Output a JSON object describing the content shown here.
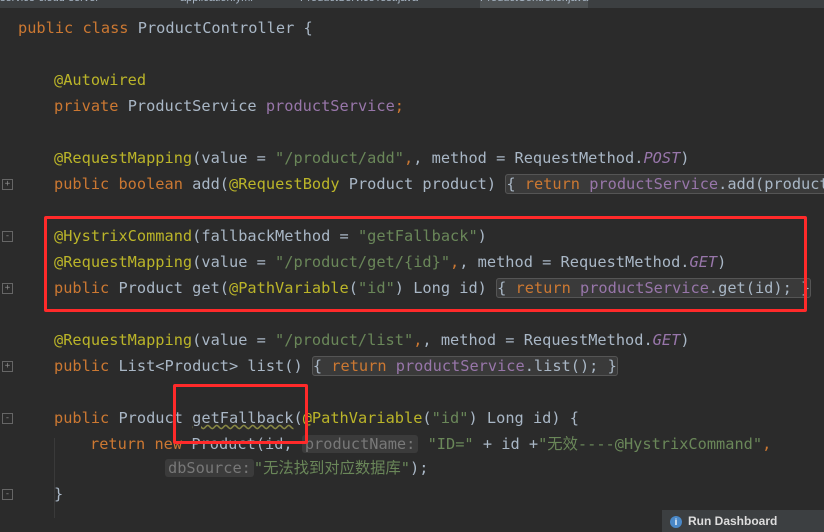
{
  "tabs": [
    {
      "label": "service-cloud-server"
    },
    {
      "label": "application.yml"
    },
    {
      "label": "ProductServiceTest.java"
    },
    {
      "label": "ProductController.java"
    }
  ],
  "code": {
    "class_decl": {
      "kw": "public class ",
      "name": "ProductController {"
    },
    "autowired": "@Autowired",
    "field": {
      "kw": "private ",
      "type": "ProductService ",
      "name": "productService",
      "end": ";"
    },
    "add_mapping": {
      "ann": "@RequestMapping",
      "p1": "(value = ",
      "path": "\"/product/add\"",
      "p2": ", method = RequestMethod.",
      "m": "POST",
      "p3": ")"
    },
    "add_method": {
      "kw1": "public boolean ",
      "name": "add",
      "p1": "(",
      "ann": "@RequestBody",
      "p2": " Product product) ",
      "fold_kw": "return ",
      "fold_fld": "productService",
      "fold_rest": ".add(product);"
    },
    "hystrix": {
      "ann": "@HystrixCommand",
      "p1": "(fallbackMethod = ",
      "val": "\"getFallback\"",
      "p2": ")"
    },
    "get_mapping": {
      "ann": "@RequestMapping",
      "p1": "(value = ",
      "path": "\"/product/get/{id}\"",
      "p2": ", method = RequestMethod.",
      "m": "GET",
      "p3": ")"
    },
    "get_method": {
      "kw": "public ",
      "p1": "Product get(",
      "ann": "@PathVariable",
      "p2": "(",
      "val": "\"id\"",
      "p3": ") Long id) ",
      "fold_kw": "return ",
      "fold_fld": "productService",
      "fold_rest": ".get(id); }"
    },
    "list_mapping": {
      "ann": "@RequestMapping",
      "p1": "(value = ",
      "path": "\"/product/list\"",
      "p2": ", method = RequestMethod.",
      "m": "GET",
      "p3": ")"
    },
    "list_method": {
      "kw": "public ",
      "p1": "List<Product> list() ",
      "fold_kw": "return ",
      "fold_fld": "productService",
      "fold_rest": ".list(); }"
    },
    "fallback_method": {
      "kw": "public ",
      "p1": "Product ",
      "name": "getFallback",
      "p2": "(",
      "ann": "@PathVariable",
      "p3": "(",
      "val": "\"id\"",
      "p4": ") Long id) {"
    },
    "return_line": {
      "kw1": "return ",
      "kw2": "new ",
      "p1": "Product(id, ",
      "hint": "productName:",
      "p2": " ",
      "val": "\"ID=\"",
      "p3": " + id +",
      "val2": "\"无效----@HystrixCommand\"",
      "p4": ","
    },
    "db_line": {
      "hint": "dbSource:",
      "val": "\"无法找到对应数据库\"",
      "p1": ");"
    },
    "close_brace": "}"
  },
  "run_dashboard": {
    "label": "Run Dashboard",
    "icon": "info-icon"
  },
  "colors": {
    "highlight_box": "#ff2a2a",
    "background": "#2b2b2b",
    "keyword": "#cc7832",
    "annotation": "#bbb529",
    "string": "#6a8759",
    "field": "#9876aa"
  }
}
